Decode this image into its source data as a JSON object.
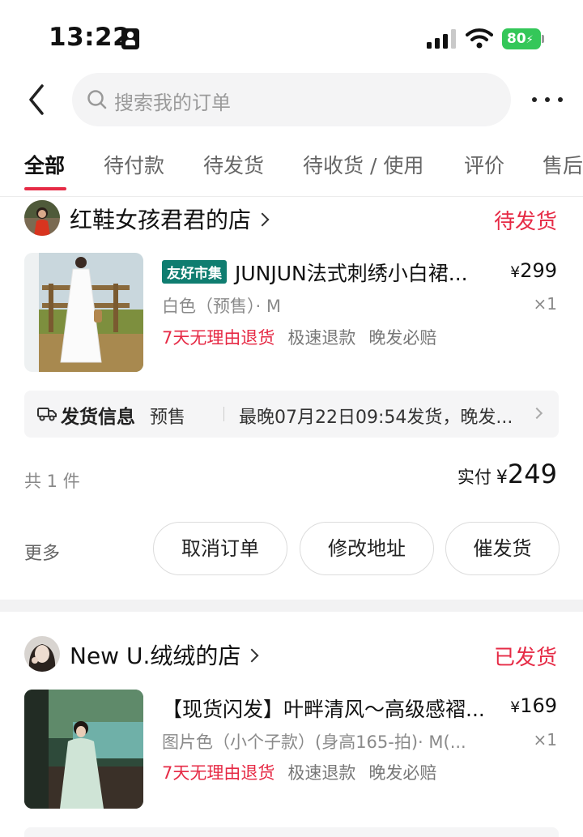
{
  "status_bar": {
    "time": "13:22",
    "battery": "80"
  },
  "header": {
    "search_placeholder": "搜索我的订单"
  },
  "tabs": [
    {
      "label": "全部",
      "active": true
    },
    {
      "label": "待付款",
      "active": false
    },
    {
      "label": "待发货",
      "active": false
    },
    {
      "label": "待收货 / 使用",
      "active": false
    },
    {
      "label": "评价",
      "active": false
    },
    {
      "label": "售后",
      "active": false
    }
  ],
  "orders": [
    {
      "shop_name": "红鞋女孩君君的店",
      "status": "待发货",
      "product": {
        "tag": "友好市集",
        "title": "JUNJUN法式刺绣小白裙...",
        "price_symbol": "¥",
        "price": "299",
        "spec": "白色（预售）· M",
        "qty": "×1",
        "perks": [
          "7天无理由退货",
          "极速退款",
          "晚发必赔"
        ]
      },
      "shipping": {
        "label": "发货信息",
        "kind": "预售",
        "text": "最晚07月22日09:54发货，晚发..."
      },
      "count": "共 1 件",
      "paid_label": "实付",
      "paid_symbol": "¥",
      "paid_amount": "249",
      "more": "更多",
      "buttons": [
        "取消订单",
        "修改地址",
        "催发货"
      ]
    },
    {
      "shop_name": "New U.绒绒的店",
      "status": "已发货",
      "product": {
        "tag": "",
        "title": "【现货闪发】叶畔清风～高级感褶...",
        "price_symbol": "¥",
        "price": "169",
        "spec": "图片色（小个子款）(身高165-拍)· M(...",
        "qty": "×1",
        "perks": [
          "7天无理由退货",
          "极速退款",
          "晚发必赔"
        ]
      }
    }
  ],
  "colors": {
    "accent_red": "#e62a45",
    "tag_green": "#0f7d70",
    "battery_green": "#34c759"
  }
}
